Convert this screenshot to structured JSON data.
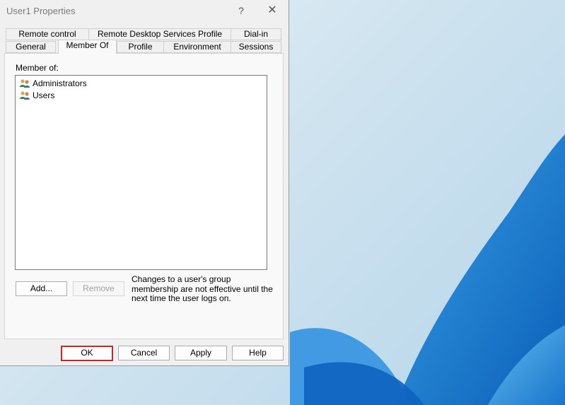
{
  "dialog": {
    "title": "User1 Properties",
    "help_glyph": "?",
    "close_glyph": "✕"
  },
  "tabs": {
    "back_row": [
      "Remote control",
      "Remote Desktop Services Profile",
      "Dial-in"
    ],
    "front_row": [
      "General",
      "Member Of",
      "Profile",
      "Environment",
      "Sessions"
    ],
    "active": "Member Of"
  },
  "member_of": {
    "label": "Member of:",
    "groups": [
      {
        "name": "Administrators",
        "icon": "group-icon"
      },
      {
        "name": "Users",
        "icon": "group-icon"
      }
    ]
  },
  "actions": {
    "add_label": "Add...",
    "remove_label": "Remove",
    "note": "Changes to a user's group membership are not effective until the next time the user logs on."
  },
  "footer": {
    "ok_label": "OK",
    "cancel_label": "Cancel",
    "apply_label": "Apply",
    "help_label": "Help"
  },
  "colors": {
    "highlight": "#c8262b",
    "desktop_blue": "#1f7fd3"
  }
}
